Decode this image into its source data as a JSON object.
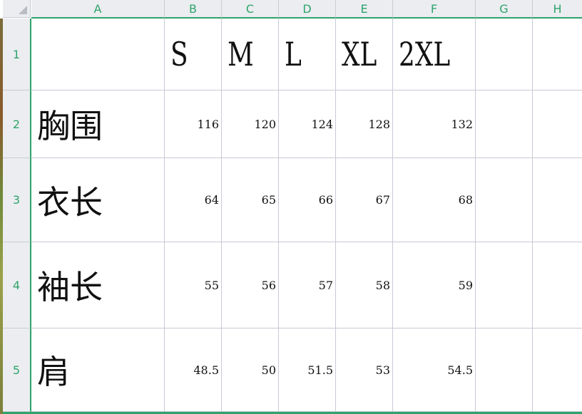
{
  "columns": [
    "A",
    "B",
    "C",
    "D",
    "E",
    "F",
    "G",
    "H"
  ],
  "rows": [
    "1",
    "2",
    "3",
    "4",
    "5"
  ],
  "sizes": [
    "S",
    "M",
    "L",
    "XL",
    "2XL"
  ],
  "measurements": [
    {
      "label": "胸围",
      "values": [
        "116",
        "120",
        "124",
        "128",
        "132"
      ]
    },
    {
      "label": "衣长",
      "values": [
        "64",
        "65",
        "66",
        "67",
        "68"
      ]
    },
    {
      "label": "袖长",
      "values": [
        "55",
        "56",
        "57",
        "58",
        "59"
      ]
    },
    {
      "label": "肩",
      "values": [
        "48.5",
        "50",
        "51.5",
        "53",
        "54.5"
      ]
    }
  ],
  "colors": {
    "accent": "#2fa36b",
    "header_bg": "#ebedf0",
    "grid": "#c8cad6"
  }
}
